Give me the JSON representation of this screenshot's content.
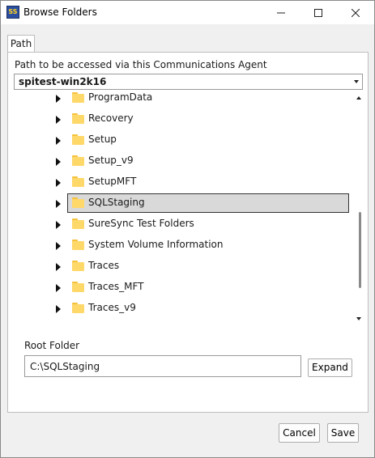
{
  "window": {
    "title": "Browse Folders"
  },
  "tabs": [
    {
      "label": "Path"
    }
  ],
  "path_section": {
    "label": "Path to be accessed via this Communications Agent",
    "selected_agent": "spitest-win2k16"
  },
  "tree": {
    "items": [
      {
        "label": "ProgramData",
        "selected": false
      },
      {
        "label": "Recovery",
        "selected": false
      },
      {
        "label": "Setup",
        "selected": false
      },
      {
        "label": "Setup_v9",
        "selected": false
      },
      {
        "label": "SetupMFT",
        "selected": false
      },
      {
        "label": "SQLStaging",
        "selected": true
      },
      {
        "label": "SureSync Test Folders",
        "selected": false
      },
      {
        "label": "System Volume Information",
        "selected": false
      },
      {
        "label": "Traces",
        "selected": false
      },
      {
        "label": "Traces_MFT",
        "selected": false
      },
      {
        "label": "Traces_v9",
        "selected": false
      }
    ],
    "colors": {
      "folder": "#ffd86a",
      "selection": "#d9d9d9"
    }
  },
  "root_folder": {
    "label": "Root Folder",
    "value": "C:\\SQLStaging",
    "expand_label": "Expand"
  },
  "footer": {
    "cancel_label": "Cancel",
    "save_label": "Save"
  }
}
